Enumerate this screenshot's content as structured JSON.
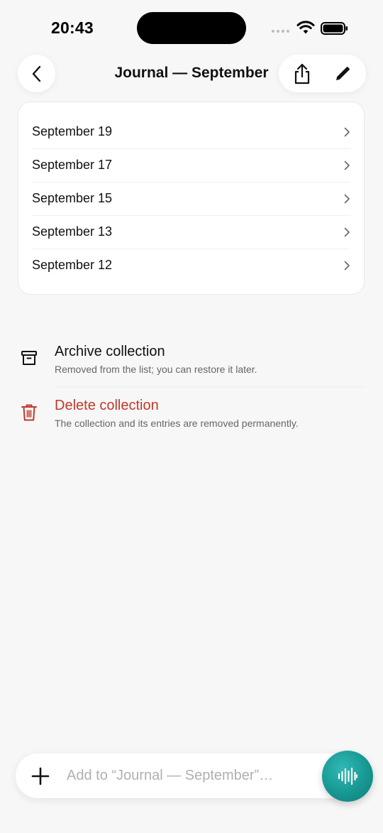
{
  "status_bar": {
    "time": "20:43"
  },
  "header": {
    "title": "Journal — September"
  },
  "entries": [
    {
      "label": "September 19"
    },
    {
      "label": "September 17"
    },
    {
      "label": "September 15"
    },
    {
      "label": "September 13"
    },
    {
      "label": "September 12"
    }
  ],
  "actions": {
    "archive": {
      "title": "Archive collection",
      "subtitle": "Removed from the list; you can restore it later."
    },
    "delete": {
      "title": "Delete collection",
      "subtitle": "The collection and its entries are removed permanently."
    }
  },
  "composer": {
    "placeholder": "Add to “Journal — September”…"
  },
  "colors": {
    "danger": "#c0392b",
    "accent": "#16948f"
  },
  "icons": [
    "back-chevron-icon",
    "share-icon",
    "edit-pencil-icon",
    "chevron-right-icon",
    "archive-box-icon",
    "trash-icon",
    "plus-icon",
    "voice-waveform-icon"
  ]
}
